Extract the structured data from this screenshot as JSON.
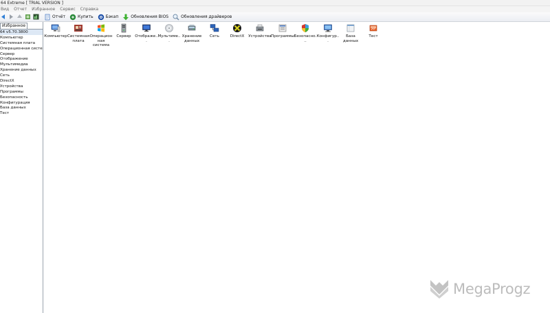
{
  "window": {
    "title": "64 Extreme  [ TRIAL VERSION ]"
  },
  "menu": [
    "Вид",
    "Отчет",
    "Избранное",
    "Сервис",
    "Справка"
  ],
  "toolbar": {
    "buttons": [
      {
        "label": "Отчёт",
        "icon": "report-icon"
      },
      {
        "label": "Купить",
        "icon": "buy-icon"
      },
      {
        "label": "Бэкап",
        "icon": "backup-icon"
      },
      {
        "label": "Обновления BIOS",
        "icon": "bios-update-icon"
      },
      {
        "label": "Обновления драйверов",
        "icon": "driver-update-icon"
      }
    ]
  },
  "sidebar": {
    "tab_label": "Избранное",
    "root": "64 v5.70.3800",
    "items": [
      "Компьютер",
      "Системная плата",
      "Операционная система",
      "Сервер",
      "Отображение",
      "Мультимедиа",
      "Хранение данных",
      "Сеть",
      "DirectX",
      "Устройства",
      "Программы",
      "Безопасность",
      "Конфигурация",
      "База данных",
      "Тест"
    ]
  },
  "categories": [
    {
      "label": "Компьютер",
      "icon": "computer-icon"
    },
    {
      "label": "Системная плата",
      "icon": "motherboard-icon"
    },
    {
      "label": "Операционная система",
      "icon": "windows-icon"
    },
    {
      "label": "Сервер",
      "icon": "server-icon"
    },
    {
      "label": "Отображе...",
      "icon": "display-icon"
    },
    {
      "label": "Мультиме...",
      "icon": "multimedia-icon"
    },
    {
      "label": "Хранение данных",
      "icon": "storage-icon"
    },
    {
      "label": "Сеть",
      "icon": "network-icon"
    },
    {
      "label": "DirectX",
      "icon": "directx-icon"
    },
    {
      "label": "Устройства",
      "icon": "devices-icon"
    },
    {
      "label": "Программы",
      "icon": "programs-icon"
    },
    {
      "label": "Безопасно...",
      "icon": "security-icon"
    },
    {
      "label": "Конфигур...",
      "icon": "config-icon"
    },
    {
      "label": "База данных",
      "icon": "database-icon"
    },
    {
      "label": "Тест",
      "icon": "benchmark-icon"
    }
  ],
  "watermark": {
    "text": "MegaProgz",
    "color": "#bcbcbc"
  }
}
